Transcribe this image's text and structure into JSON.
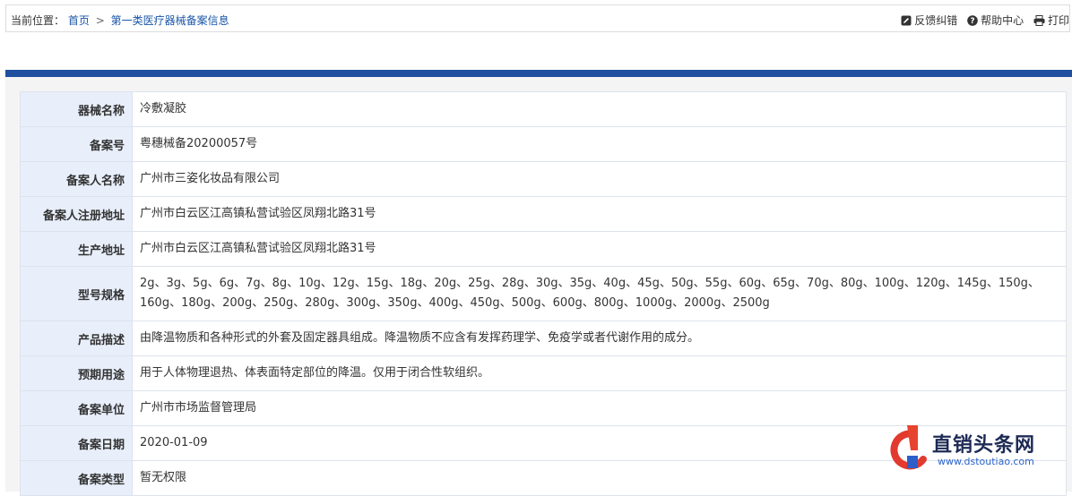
{
  "breadcrumb": {
    "label": "当前位置：",
    "home": "首页",
    "separator": ">",
    "current": "第一类医疗器械备案信息"
  },
  "tools": {
    "feedback": "反馈纠错",
    "help": "帮助中心",
    "print": "打印"
  },
  "record": [
    {
      "label": "器械名称",
      "value": "冷敷凝胶"
    },
    {
      "label": "备案号",
      "value": "粤穗械备20200057号"
    },
    {
      "label": "备案人名称",
      "value": "广州市三姿化妆品有限公司"
    },
    {
      "label": "备案人注册地址",
      "value": "广州市白云区江高镇私营试验区凤翔北路31号"
    },
    {
      "label": "生产地址",
      "value": "广州市白云区江高镇私营试验区凤翔北路31号"
    },
    {
      "label": "型号规格",
      "value": "2g、3g、5g、6g、7g、8g、10g、12g、15g、18g、20g、25g、28g、30g、35g、40g、45g、50g、55g、60g、65g、70g、80g、100g、120g、145g、150g、160g、180g、200g、250g、280g、300g、350g、400g、450g、500g、600g、800g、1000g、2000g、2500g"
    },
    {
      "label": "产品描述",
      "value": "由降温物质和各种形式的外套及固定器具组成。降温物质不应含有发挥药理学、免疫学或者代谢作用的成分。"
    },
    {
      "label": "预期用途",
      "value": "用于人体物理退热、体表面特定部位的降温。仅用于闭合性软组织。"
    },
    {
      "label": "备案单位",
      "value": "广州市市场监督管理局"
    },
    {
      "label": "备案日期",
      "value": "2020-01-09"
    },
    {
      "label": "备案类型",
      "value": "暂无权限"
    }
  ],
  "watermark": {
    "title": "直销头条网",
    "url": "www.dstoutiao.com"
  },
  "colors": {
    "accent": "#1f4f9e",
    "link": "#1a56a8",
    "label_bg": "#e8effa"
  }
}
